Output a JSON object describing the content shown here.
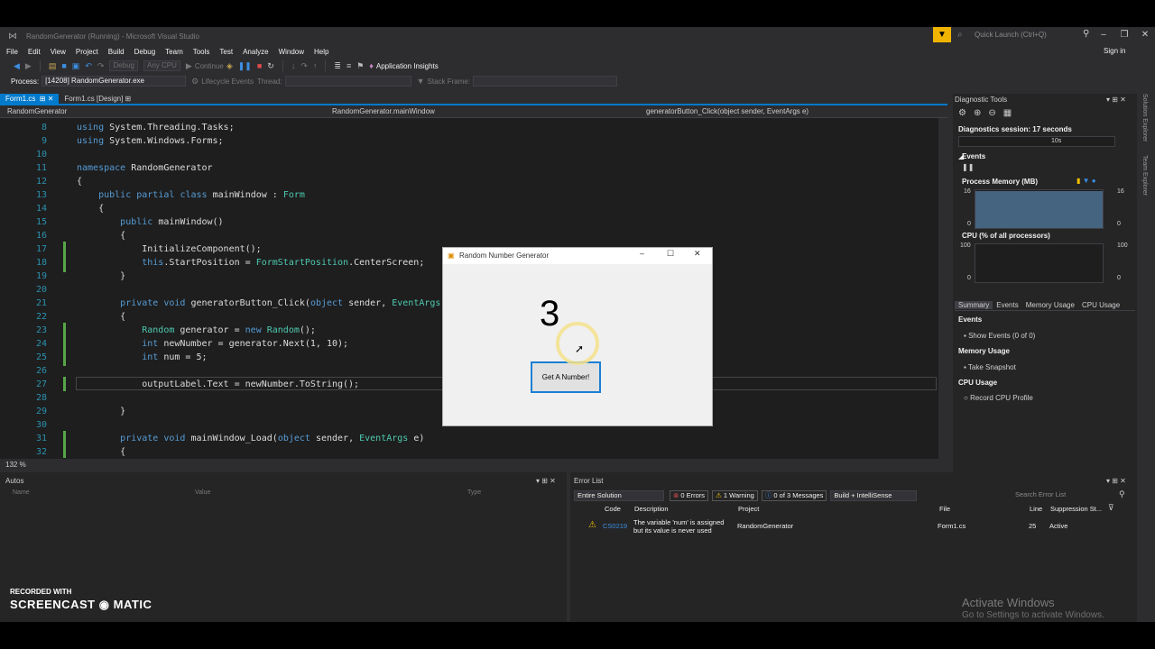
{
  "window": {
    "title": "RandomGenerator (Running) - Microsoft Visual Studio",
    "quick_launch_placeholder": "Quick Launch (Ctrl+Q)",
    "sign_in": "Sign in"
  },
  "menu": [
    "File",
    "Edit",
    "View",
    "Project",
    "Build",
    "Debug",
    "Team",
    "Tools",
    "Test",
    "Analyze",
    "Window",
    "Help"
  ],
  "toolbar": {
    "config": "Debug",
    "platform": "Any CPU",
    "continue": "Continue",
    "app_insights": "Application Insights",
    "process_label": "Process:",
    "process_value": "[14208] RandomGenerator.exe",
    "lifecycle": "Lifecycle Events",
    "thread": "Thread:",
    "stack_frame": "Stack Frame:"
  },
  "editor": {
    "tabs": [
      "Form1.cs",
      "Form1.cs [Design]"
    ],
    "nav_project": "RandomGenerator",
    "nav_class": "RandomGenerator.mainWindow",
    "nav_member": "generatorButton_Click(object sender, EventArgs e)",
    "zoom": "132 %",
    "lines": [
      {
        "n": "8",
        "code": "using System.Threading.Tasks;"
      },
      {
        "n": "9",
        "code": "using System.Windows.Forms;"
      },
      {
        "n": "10",
        "code": ""
      },
      {
        "n": "11",
        "code": "namespace RandomGenerator"
      },
      {
        "n": "12",
        "code": "{"
      },
      {
        "n": "13",
        "code": "    public partial class mainWindow : Form"
      },
      {
        "n": "14",
        "code": "    {"
      },
      {
        "n": "15",
        "code": "        public mainWindow()"
      },
      {
        "n": "16",
        "code": "        {"
      },
      {
        "n": "17",
        "code": "            InitializeComponent();"
      },
      {
        "n": "18",
        "code": "            this.StartPosition = FormStartPosition.CenterScreen;"
      },
      {
        "n": "19",
        "code": "        }"
      },
      {
        "n": "20",
        "code": ""
      },
      {
        "n": "21",
        "code": "        private void generatorButton_Click(object sender, EventArgs e)"
      },
      {
        "n": "22",
        "code": "        {"
      },
      {
        "n": "23",
        "code": "            Random generator = new Random();"
      },
      {
        "n": "24",
        "code": "            int newNumber = generator.Next(1, 10);"
      },
      {
        "n": "25",
        "code": "            int num = 5;"
      },
      {
        "n": "26",
        "code": ""
      },
      {
        "n": "27",
        "code": "            outputLabel.Text = newNumber.ToString();"
      },
      {
        "n": "28",
        "code": ""
      },
      {
        "n": "29",
        "code": "        }"
      },
      {
        "n": "30",
        "code": ""
      },
      {
        "n": "31",
        "code": "        private void mainWindow_Load(object sender, EventArgs e)"
      },
      {
        "n": "32",
        "code": "        {"
      }
    ]
  },
  "diagnostics": {
    "title": "Diagnostic Tools",
    "session": "Diagnostics session: 17 seconds",
    "timeline_tick": "10s",
    "events": "Events",
    "memory_title": "Process Memory (MB)",
    "memory_max": "16",
    "memory_min": "0",
    "cpu_title": "CPU (% of all processors)",
    "cpu_max": "100",
    "cpu_min": "0",
    "tabs": [
      "Summary",
      "Events",
      "Memory Usage",
      "CPU Usage"
    ],
    "summary_events": "Events",
    "show_events": "Show Events (0 of 0)",
    "memory_usage": "Memory Usage",
    "take_snapshot": "Take Snapshot",
    "cpu_usage": "CPU Usage",
    "record_cpu": "Record CPU Profile",
    "side_tabs": [
      "Solution Explorer",
      "Team Explorer"
    ]
  },
  "autos": {
    "title": "Autos",
    "columns": [
      "Name",
      "Value",
      "Type"
    ]
  },
  "error_list": {
    "title": "Error List",
    "scope": "Entire Solution",
    "errors": "0 Errors",
    "warnings": "1 Warning",
    "messages": "0 of 3 Messages",
    "build_filter": "Build + IntelliSense",
    "search_placeholder": "Search Error List",
    "columns": [
      "Code",
      "Description",
      "Project",
      "File",
      "Line",
      "Suppression St..."
    ],
    "row": {
      "code": "CS0219",
      "description_1": "The variable 'num' is assigned",
      "description_2": "but its value is never used",
      "project": "RandomGenerator",
      "file": "Form1.cs",
      "line": "25",
      "suppression": "Active"
    }
  },
  "form": {
    "title": "Random Number Generator",
    "output": "3",
    "button": "Get A Number!"
  },
  "watermark": {
    "recorded_with": "RECORDED WITH",
    "brand": "SCREENCAST ◉ MATIC",
    "activate_title": "Activate Windows",
    "activate_sub": "Go to Settings to activate Windows."
  },
  "colors": {
    "accent": "#007acc",
    "editor_bg": "#1e1e1e",
    "shell_bg": "#2d2d30",
    "warning": "#f0c000"
  }
}
